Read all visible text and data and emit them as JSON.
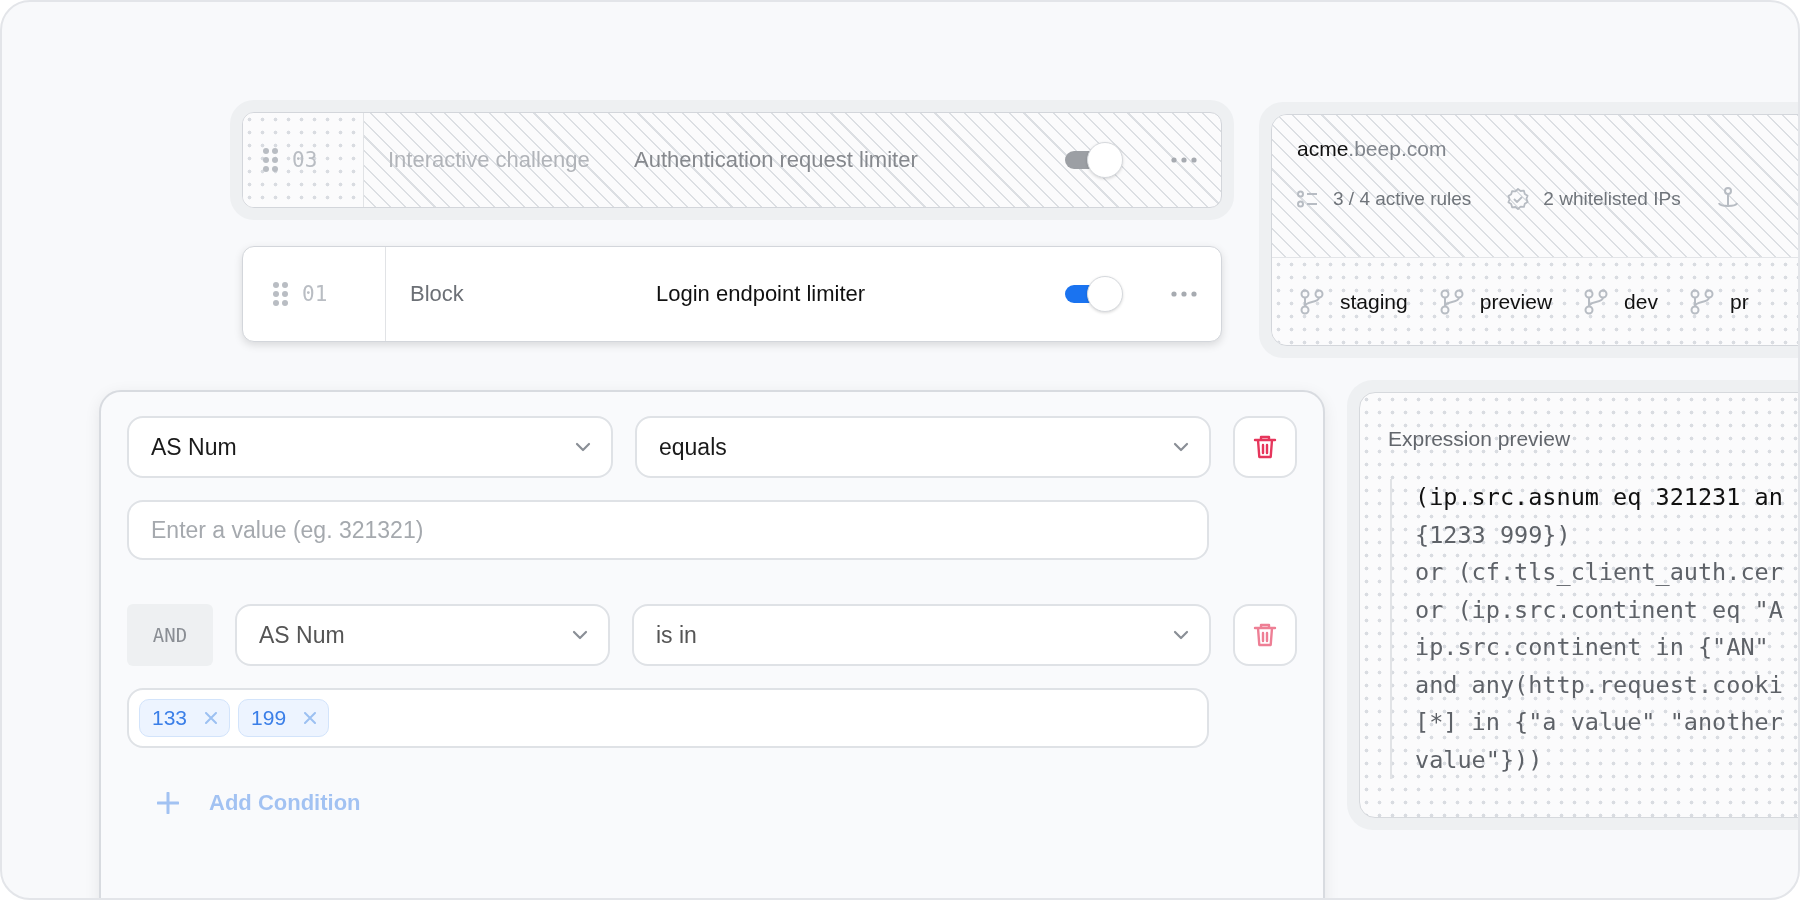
{
  "rules": [
    {
      "number": "03",
      "action": "Interactive challenge",
      "name": "Authentication request limiter",
      "disabled": true,
      "on": true
    },
    {
      "number": "01",
      "action": "Block",
      "name": "Login endpoint limiter",
      "disabled": false,
      "on": true
    }
  ],
  "site": {
    "host": "acme",
    "domain": ".beep.com",
    "stats": [
      {
        "label": "3 / 4 active rules"
      },
      {
        "label": "2 whitelisted IPs"
      }
    ],
    "branches": [
      "staging",
      "preview",
      "dev",
      "pr"
    ]
  },
  "conditions": [
    {
      "field": "AS Num",
      "operator": "equals",
      "value_placeholder": "Enter a value (eg. 321321)"
    },
    {
      "connector": "AND",
      "field": "AS Num",
      "operator": "is in",
      "tags": [
        "133",
        "199"
      ]
    }
  ],
  "add_condition": {
    "label": "Add Condition"
  },
  "expression_preview": {
    "title": "Expression preview",
    "lines": [
      {
        "text": "(ip.src.asnum eq 321231 an",
        "highlighted": true
      },
      {
        "text": "{1233 999})",
        "highlighted": false
      },
      {
        "text": "or (cf.tls_client_auth.cer",
        "highlighted": false
      },
      {
        "text": "or (ip.src.continent eq \"A",
        "highlighted": false
      },
      {
        "text": "ip.src.continent in {\"AN\"",
        "highlighted": false
      },
      {
        "text": "and any(http.request.cooki",
        "highlighted": false
      },
      {
        "text": "[*] in {\"a value\" \"another",
        "highlighted": false
      },
      {
        "text": "value\"}))",
        "highlighted": false
      }
    ]
  }
}
